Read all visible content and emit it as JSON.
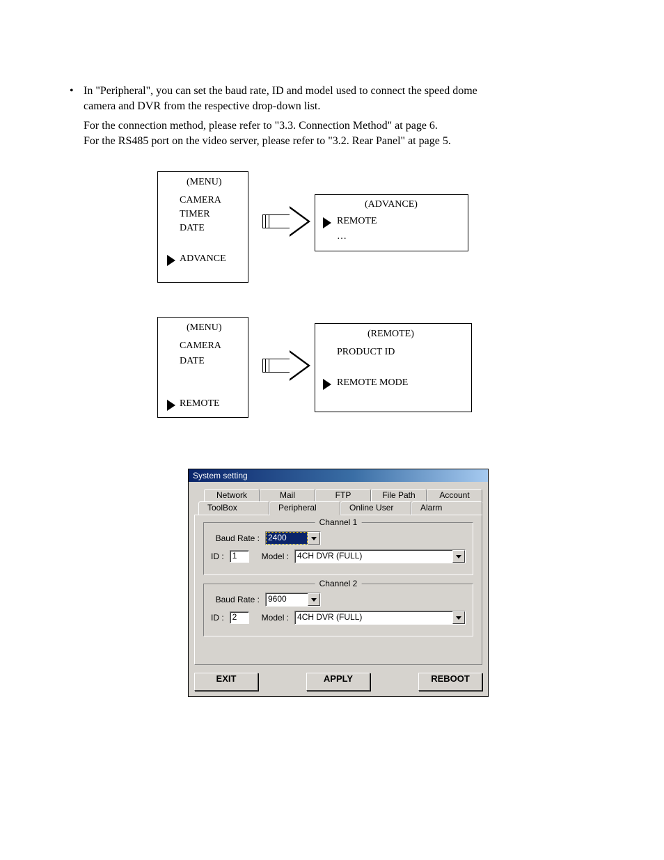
{
  "instructions": {
    "line1": "In \"Peripheral\", you can set the baud rate, ID and model used to connect the speed dome",
    "line2": "camera and DVR from the respective drop-down list.",
    "line3": "For the connection method, please refer to \"3.3. Connection Method\" at page 6.",
    "line4": "For the RS485 port on the video server, please refer to \"3.2. Rear Panel\" at page 5."
  },
  "flow1": {
    "menu": {
      "title": "(MENU)",
      "item1": "CAMERA",
      "item2": "TIMER",
      "item3": "DATE",
      "item4": "ADVANCE",
      "item_sel_tri": true
    },
    "advance": {
      "title": "(ADVANCE)",
      "item1": "REMOTE",
      "item_sel_tri": true,
      "item2": "…"
    }
  },
  "flow2": {
    "menu": {
      "title": "(MENU)",
      "item1": "CAMERA",
      "item2": "DATE",
      "item3": "REMOTE",
      "item_sel_tri": true
    },
    "remote": {
      "title": "(REMOTE)",
      "item1": "PRODUCT ID",
      "item2": "REMOTE MODE",
      "item_sel_tri": true
    }
  },
  "dlg": {
    "title": "System setting",
    "tabs_row1": [
      "Network",
      "Mail",
      "FTP",
      "File Path",
      "Account"
    ],
    "tabs_row2": [
      "ToolBox",
      "Peripheral",
      "Online User",
      "Alarm"
    ],
    "active_tab": "Peripheral",
    "ch1": {
      "legend": "Channel 1",
      "baud_label": "Baud Rate :",
      "baud_value": "2400",
      "id_label": "ID :",
      "id_value": "1",
      "model_label": "Model :",
      "model_value": "4CH DVR (FULL)"
    },
    "ch2": {
      "legend": "Channel 2",
      "baud_label": "Baud Rate :",
      "baud_value": "9600",
      "id_label": "ID :",
      "id_value": "2",
      "model_label": "Model :",
      "model_value": "4CH DVR (FULL)"
    },
    "buttons": {
      "exit": "EXIT",
      "apply": "APPLY",
      "reboot": "REBOOT"
    }
  },
  "bullet": "•"
}
